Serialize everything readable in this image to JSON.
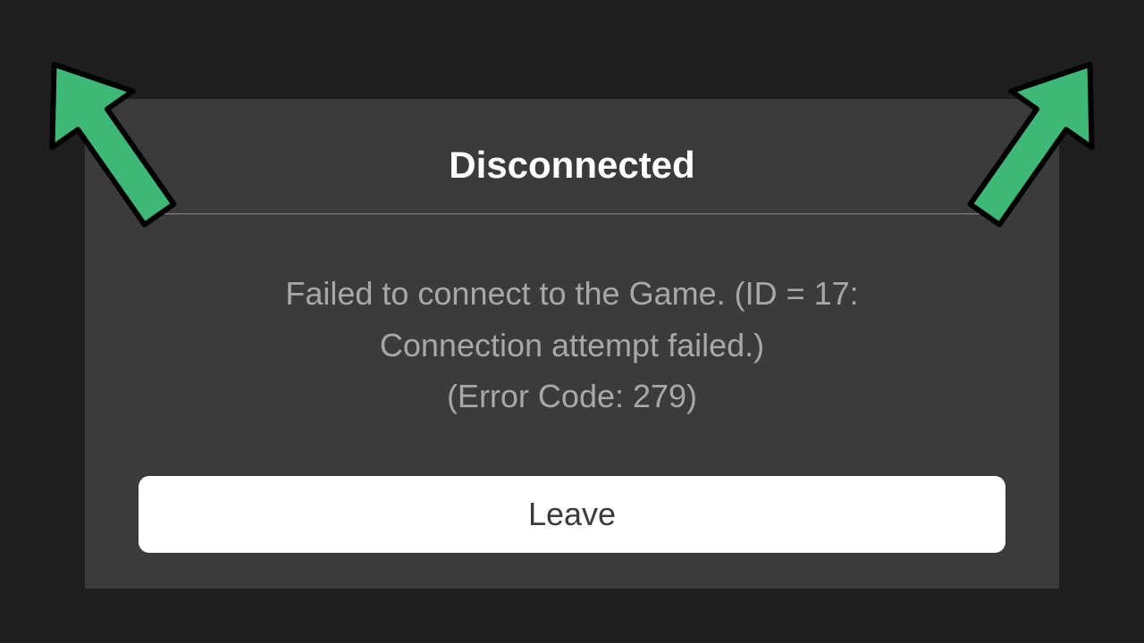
{
  "dialog": {
    "title": "Disconnected",
    "message_line1": "Failed to connect to the Game. (ID = 17:",
    "message_line2": "Connection attempt failed.)",
    "message_line3": "(Error Code: 279)",
    "button_label": "Leave"
  },
  "colors": {
    "arrow_fill": "#3eb877",
    "arrow_stroke": "#000000"
  }
}
